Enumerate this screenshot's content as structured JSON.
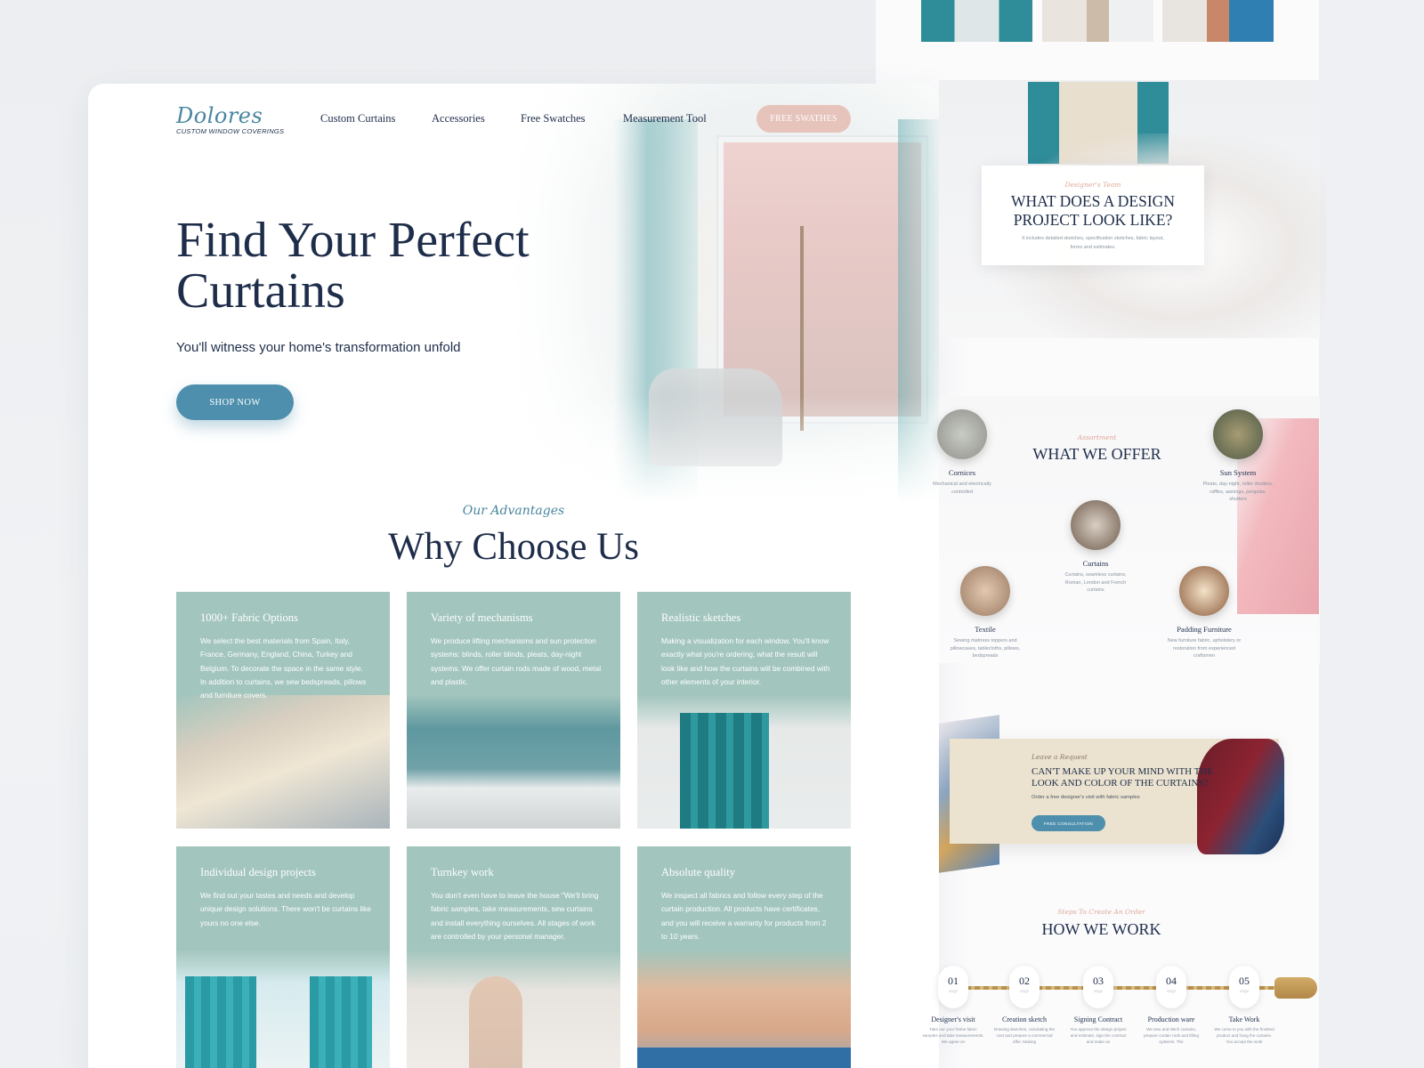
{
  "colors": {
    "navy": "#1e2d4a",
    "teal_button": "#4d8fad",
    "sage_card": "#a2c5bd",
    "pink_button": "#e6c3bb",
    "script_blue": "#4a86a0",
    "eyebrow_pink": "#e0a89a"
  },
  "brand": {
    "name": "Dolores",
    "tagline": "CUSTOM WINDOW COVERINGS"
  },
  "nav": {
    "items": [
      "Custom Curtains",
      "Accessories",
      "Free Swatches",
      "Measurement Tool"
    ],
    "cta": "FREE SWATHES"
  },
  "hero": {
    "title": "Find Your Perfect Curtains",
    "subtitle": "You'll witness your home's transformation unfold",
    "button": "SHOP NOW"
  },
  "advantages": {
    "eyebrow": "Our Advantages",
    "title": "Why Choose Us",
    "items": [
      {
        "title": "1000+ Fabric Options",
        "text": "We select the best materials from Spain, Italy, France, Germany, England, China, Turkey and Belgium. To decorate the space in the same style. In addition to curtains, we sew bedspreads, pillows and furniture covers."
      },
      {
        "title": "Variety of mechanisms",
        "text": "We produce lifting mechanisms and sun protection systems: blinds, roller blinds, pleats, day-night systems. We offer curtain rods made of wood, metal and plastic."
      },
      {
        "title": "Realistic sketches",
        "text": "Making a visualization for each window. You'll know exactly what you're ordering, what the result will look like and how the curtains will be combined with other elements of your interior."
      },
      {
        "title": "Individual design projects",
        "text": "We find out your tastes and needs and develop unique design solutions. There won't be curtains like yours no one else."
      },
      {
        "title": "Turnkey work",
        "text": "You don't even have to leave the house \"We'll bring fabric samples, take measurements, sew curtains and install everything ourselves. All stages of work are controlled by your personal manager."
      },
      {
        "title": "Absolute  quality",
        "text": "We inspect all fabrics and follow every step of the curtain production. All products have certificates, and you will receive a warranty for products from 2 to 10 years."
      }
    ]
  },
  "project": {
    "eyebrow": "Designer's Team",
    "title": "WHAT DOES A DESIGN PROJECT LOOK LIKE?",
    "text": "It includes detailed sketches, specification sketches, fabric layout, forms and estimates."
  },
  "offer": {
    "eyebrow": "Assortment",
    "title": "WHAT WE OFFER",
    "items": [
      {
        "name": "Cornices",
        "desc": "Mechanical and electrically controlled"
      },
      {
        "name": "Sun System",
        "desc": "Pleats, day-night, roller shutters, raffles, awnings, pergolas, shutters"
      },
      {
        "name": "Curtains",
        "desc": "Curtains, seamless curtains, Roman, London and French curtains"
      },
      {
        "name": "Textile",
        "desc": "Sewing mattress toppers and pillowcases, tablecloths, pillows, bedspreads"
      },
      {
        "name": "Padding Furniture",
        "desc": "New furniture fabric, upholstery or restoration from experienced craftsmen"
      }
    ]
  },
  "cta": {
    "eyebrow": "Leave a Request",
    "title": "CAN'T MAKE UP YOUR MIND WITH THE LOOK AND COLOR OF THE CURTAINS?",
    "text": "Order a free designer's visit with fabric samples",
    "button": "FREE CONSULTATION"
  },
  "how": {
    "eyebrow": "Steps To Create An Order",
    "title": "HOW WE WORK",
    "step_label": "stage",
    "steps": [
      {
        "num": "01",
        "name": "Designer's visit",
        "desc": "Take our your frame fabric samples and take measurements. We agree on"
      },
      {
        "num": "02",
        "name": "Creation sketch",
        "desc": "Drawing sketches, calculating the cost and prepare a commercial offer. Making"
      },
      {
        "num": "03",
        "name": "Signing Contract",
        "desc": "You approve the design project and estimate, sign the contract and make an"
      },
      {
        "num": "04",
        "name": "Production ware",
        "desc": "We sew and stitch curtains, prepare curtain rods and lifting systems. The"
      },
      {
        "num": "05",
        "name": "Take Work",
        "desc": "We come to you with the finished product and hang the curtains. You accept the work"
      }
    ]
  }
}
